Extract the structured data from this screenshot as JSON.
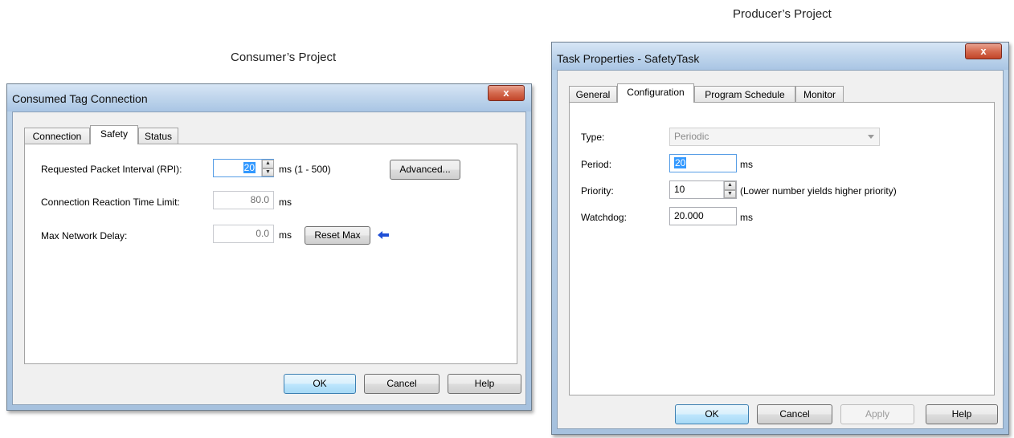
{
  "captions": {
    "producer": "Producer’s Project",
    "consumer": "Consumer’s Project"
  },
  "consumer_dialog": {
    "title": "Consumed Tag Connection",
    "close_glyph": "x",
    "tabs": [
      "Connection",
      "Safety",
      "Status"
    ],
    "active_tab": "Safety",
    "rpi_label": "Requested Packet Interval (RPI):",
    "rpi_value": "20",
    "rpi_unit_range": "ms  (1 - 500)",
    "advanced_label": "Advanced...",
    "crtl_label": "Connection Reaction Time Limit:",
    "crtl_value": "80.0",
    "crtl_unit": "ms",
    "mnd_label": "Max Network Delay:",
    "mnd_value": "0.0",
    "mnd_unit": "ms",
    "reset_max_label": "Reset Max",
    "ok_label": "OK",
    "cancel_label": "Cancel",
    "help_label": "Help"
  },
  "producer_dialog": {
    "title": "Task Properties - SafetyTask",
    "close_glyph": "x",
    "tabs": [
      "General",
      "Configuration",
      "Program Schedule",
      "Monitor"
    ],
    "active_tab": "Configuration",
    "type_label": "Type:",
    "type_value": "Periodic",
    "period_label": "Period:",
    "period_value": "20",
    "period_unit": "ms",
    "priority_label": "Priority:",
    "priority_value": "10",
    "priority_hint": "(Lower number yields higher priority)",
    "watchdog_label": "Watchdog:",
    "watchdog_value": "20.000",
    "watchdog_unit": "ms",
    "ok_label": "OK",
    "cancel_label": "Cancel",
    "apply_label": "Apply",
    "help_label": "Help"
  },
  "icons": {
    "reset_arrow": "left-arrow-icon",
    "arrow_color": "#1f4fd6"
  }
}
